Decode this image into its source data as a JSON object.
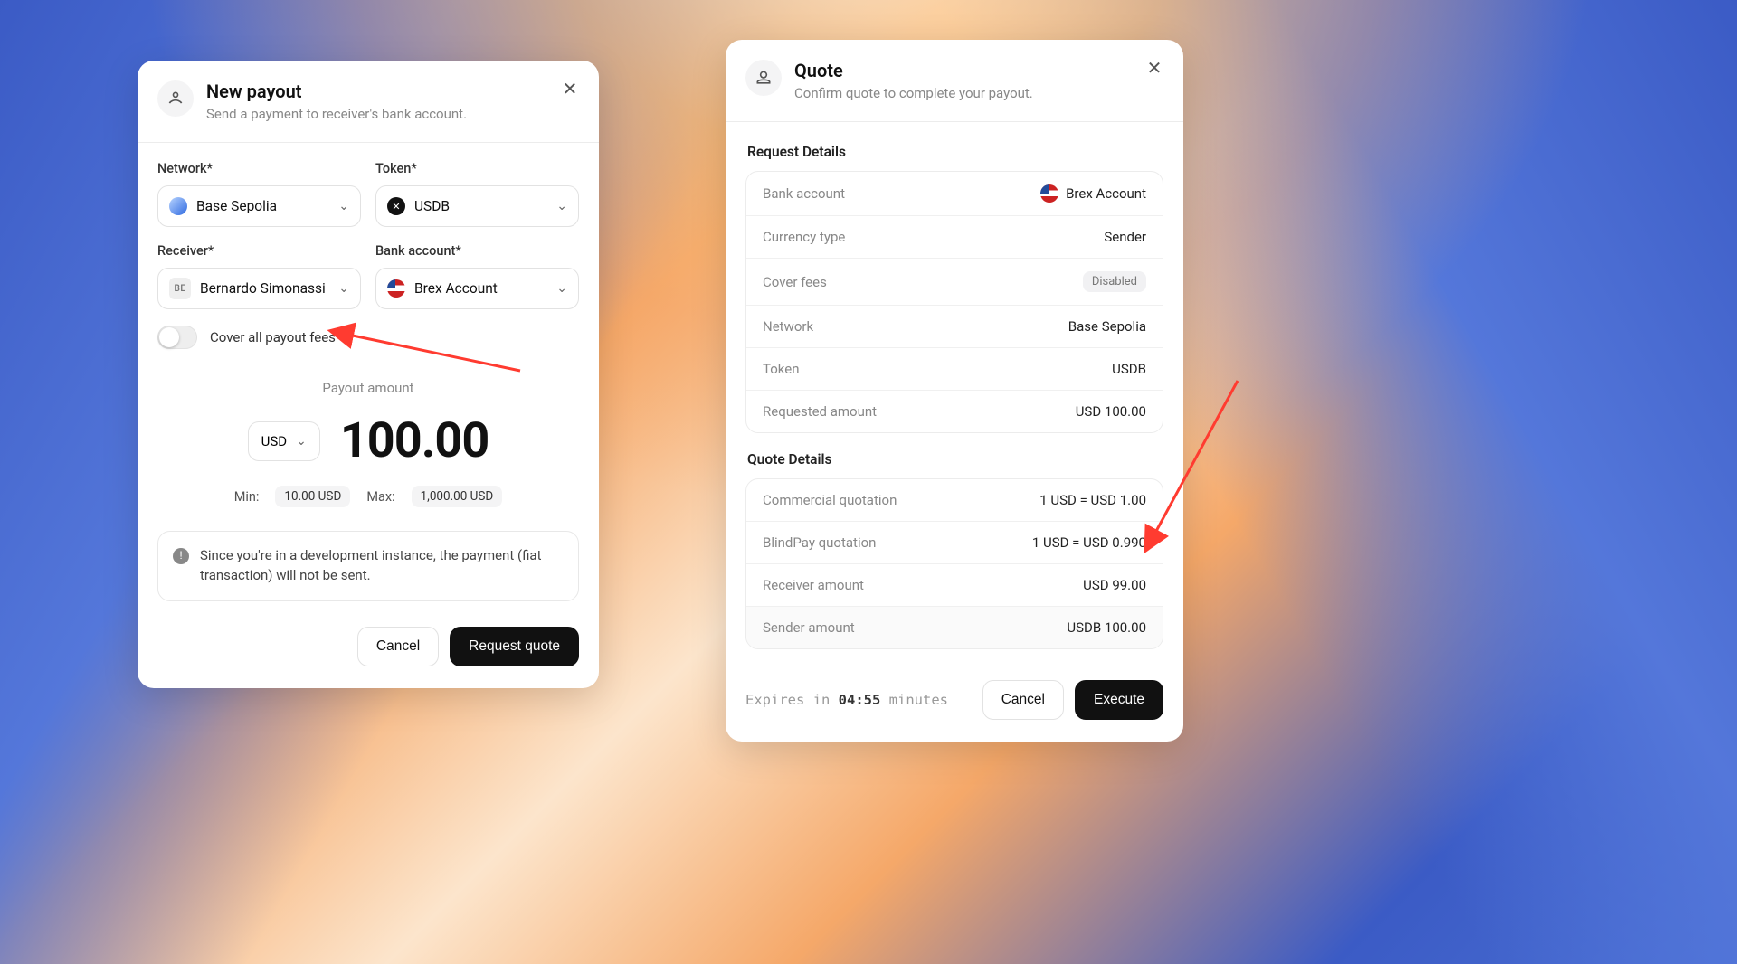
{
  "left": {
    "title": "New payout",
    "subtitle": "Send a payment to receiver's bank account.",
    "network_label": "Network*",
    "network_value": "Base Sepolia",
    "token_label": "Token*",
    "token_value": "USDB",
    "receiver_label": "Receiver*",
    "receiver_value": "Bernardo Simonassi",
    "receiver_initials": "BE",
    "bank_label": "Bank account*",
    "bank_value": "Brex Account",
    "toggle_label": "Cover all payout fees",
    "amount_caption": "Payout amount",
    "currency": "USD",
    "amount": "100.00",
    "min_label": "Min:",
    "min_value": "10.00 USD",
    "max_label": "Max:",
    "max_value": "1,000.00 USD",
    "notice": "Since you're in a development instance, the payment (fiat transaction) will not be sent.",
    "cancel": "Cancel",
    "submit": "Request quote"
  },
  "right": {
    "title": "Quote",
    "subtitle": "Confirm quote to complete your payout.",
    "req_title": "Request Details",
    "req": [
      {
        "k": "Bank account",
        "v": "Brex Account",
        "icon": "us"
      },
      {
        "k": "Currency type",
        "v": "Sender"
      },
      {
        "k": "Cover fees",
        "v": "Disabled",
        "badge": true
      },
      {
        "k": "Network",
        "v": "Base Sepolia"
      },
      {
        "k": "Token",
        "v": "USDB"
      },
      {
        "k": "Requested amount",
        "v": "USD 100.00"
      }
    ],
    "quote_title": "Quote Details",
    "quote": [
      {
        "k": "Commercial quotation",
        "v": "1 USD = USD 1.00"
      },
      {
        "k": "BlindPay quotation",
        "v": "1 USD = USD 0.990"
      },
      {
        "k": "Receiver amount",
        "v": "USD 99.00"
      },
      {
        "k": "Sender amount",
        "v": "USDB 100.00",
        "hl": true
      }
    ],
    "expire_prefix": "Expires in ",
    "expire_time": "04:55",
    "expire_suffix": " minutes",
    "cancel": "Cancel",
    "submit": "Execute"
  }
}
